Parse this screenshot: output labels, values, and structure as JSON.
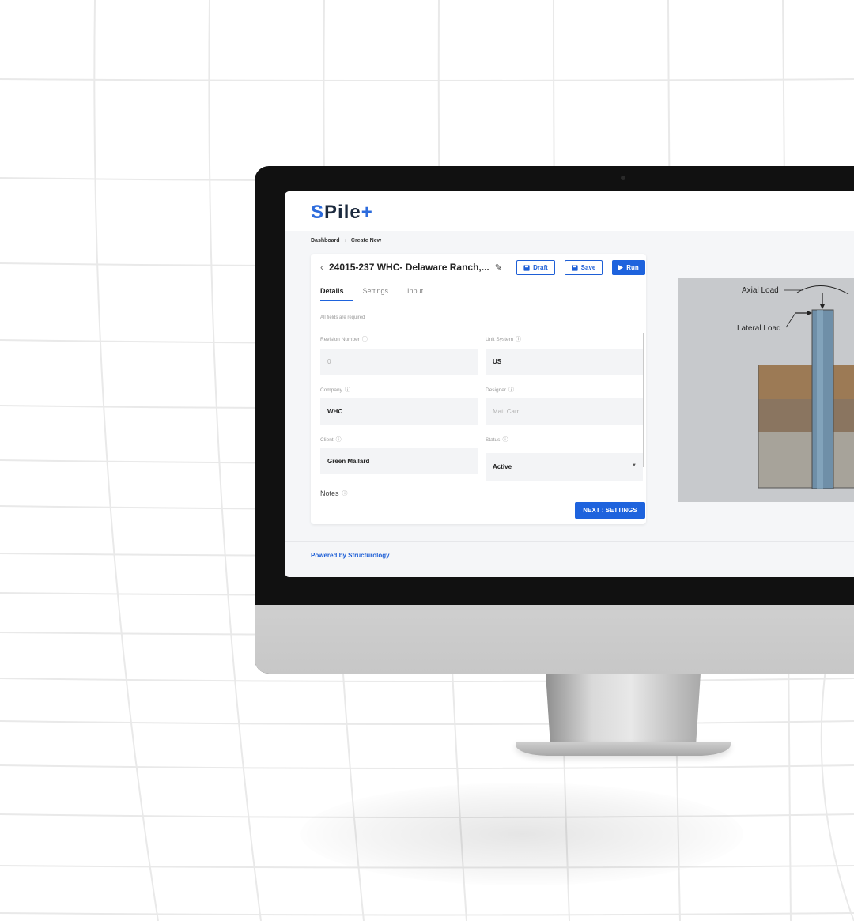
{
  "app": {
    "logo_s": "S",
    "logo_rest": "Pile",
    "logo_plus": "+"
  },
  "breadcrumb": {
    "items": [
      "Dashboard",
      "Create New"
    ],
    "separator": "›"
  },
  "project": {
    "title": "24015-237 WHC- Delaware Ranch,..."
  },
  "actions": {
    "draft": "Draft",
    "save": "Save",
    "run": "Run"
  },
  "tabs": [
    "Details",
    "Settings",
    "Input"
  ],
  "form": {
    "required_note": "All fields are required",
    "revision_number": {
      "label": "Revision Number",
      "value": "0"
    },
    "unit_system": {
      "label": "Unit System",
      "value": "US"
    },
    "company": {
      "label": "Company",
      "value": "WHC"
    },
    "designer": {
      "label": "Designer",
      "value": "Matt Carr"
    },
    "client": {
      "label": "Client",
      "value": "Green Mallard"
    },
    "status": {
      "label": "Status",
      "value": "Active"
    },
    "notes": {
      "label": "Notes"
    },
    "next_button": "NEXT : SETTINGS"
  },
  "diagram": {
    "axial_load": "Axial Load",
    "lateral_load": "Lateral Load"
  },
  "footer": {
    "text": "Powered by Structurology"
  },
  "icons": {
    "back": "chevron-left-icon",
    "edit": "pencil-icon",
    "save_disk": "floppy-disk-icon",
    "play": "play-icon",
    "info": "info-icon",
    "dropdown": "caret-down-icon"
  },
  "colors": {
    "accent": "#1e63dd",
    "brand_dark": "#1c2a3e"
  }
}
